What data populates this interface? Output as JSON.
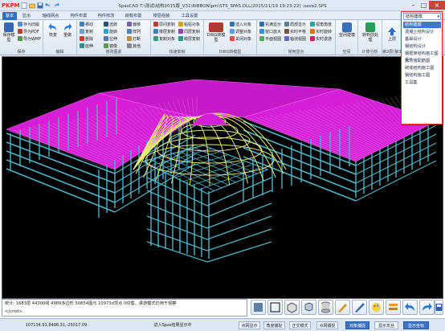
{
  "app": {
    "logo": "PKPM",
    "title": "SpasCAD T:\\测试\\结构2015版_V31\\RIBBON\\pm\\STS_SPAS.DLL(2015/11/19 19:23:22) :save2.SPS"
  },
  "tabs": [
    "基本",
    "显示",
    "轴线网点",
    "构件布置",
    "构件修改",
    "荷载布置",
    "楼层组装",
    "工具设置"
  ],
  "ribbon": {
    "groups": [
      {
        "label": "保存",
        "big": [
          "保存模型"
        ],
        "small": [
          "存为旧版",
          "导为PDF",
          "导为WMF"
        ]
      },
      {
        "label": "编辑",
        "big": [
          "恢复",
          "重做"
        ],
        "small": []
      },
      {
        "label": "修改图素",
        "big": [],
        "small": [
          "移动",
          "复制",
          "删除",
          "选转",
          "旋转",
          "拉伸",
          "镜像",
          "偏移",
          "阵列",
          "打断",
          "延伸",
          "其他"
        ]
      },
      {
        "label": "快速复制",
        "big": [],
        "small": [
          "层间复制",
          "楼层复制",
          "复制对象",
          "粘贴对象",
          "同层复制",
          "跨层复制"
        ]
      },
      {
        "label": "DWG转模型",
        "big": [
          "DWG转模型"
        ],
        "small": [
          "插入对象",
          "调整对象",
          "关闭对象"
        ]
      },
      {
        "label": "常用显示",
        "big": [],
        "small": [
          "充满显示",
          "窗口放大",
          "平面视图",
          "局部显示",
          "实时平移",
          "轴测视图",
          "视角角度",
          "实时旋转",
          "实时漫游"
        ]
      },
      {
        "label": "空间",
        "big": [
          "空间建模"
        ],
        "small": []
      },
      {
        "label": "计算分析",
        "big": [
          "转到前处理"
        ],
        "small": []
      },
      {
        "label": "第2层(第3标)",
        "big": [
          "上层"
        ],
        "small": []
      }
    ]
  },
  "module_dropdown": {
    "selected": "结构建模",
    "options": [
      "结构建模",
      "混凝土结构设计",
      "基础设计",
      "钢结构设计",
      "钢框架结构施工图设计",
      "剪力墙配筋图",
      "砌体结构施工图",
      "钢结构施工图",
      "工具集"
    ],
    "highlighted_index": 0
  },
  "command_panel": {
    "line1": "统计:    1683层    44300线    4989多边形    50854图元    10973d顶点    0纹理，漫游模式仍用于观察",
    "line2": "</cmd>"
  },
  "toolbar_icons": [
    "fill-icon",
    "box-icon",
    "cube-icon",
    "3d-icon",
    "cylinder-icon",
    "brush-icon",
    "pen-icon",
    "palette-icon",
    "layer-icon",
    "ruler-icon",
    "undo-icon",
    "redo-icon",
    "save-icon"
  ],
  "statusbar": {
    "coords": "107134.91,8408.31,-25017.09",
    "prompt": "进入Spas结果显示中",
    "buttons": [
      {
        "label": "点网显示",
        "on": false
      },
      {
        "label": "角度捕捉",
        "on": false
      },
      {
        "label": "正交模式",
        "on": false
      },
      {
        "label": "点网捕捉",
        "on": false
      },
      {
        "label": "对象捕捉",
        "on": true
      },
      {
        "label": "显示叉丝",
        "on": false
      },
      {
        "label": "显示坐标",
        "on": true
      }
    ]
  }
}
